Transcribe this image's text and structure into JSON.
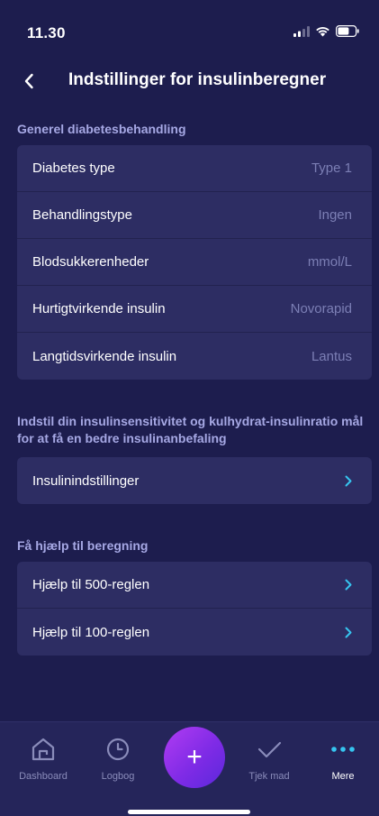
{
  "status_bar": {
    "time": "11.30",
    "icons": [
      "signal-icon",
      "wifi-icon",
      "battery-icon"
    ]
  },
  "header": {
    "title": "Indstillinger for insulinberegner",
    "back_icon": "chevron-left-icon"
  },
  "section_general": {
    "title": "Generel diabetesbehandling",
    "rows": [
      {
        "label": "Diabetes type",
        "value": "Type 1"
      },
      {
        "label": "Behandlingstype",
        "value": "Ingen"
      },
      {
        "label": "Blodsukkerenheder",
        "value": "mmol/L"
      },
      {
        "label": "Hurtigtvirkende insulin",
        "value": "Novorapid"
      },
      {
        "label": "Langtidsvirkende insulin",
        "value": "Lantus"
      }
    ]
  },
  "section_insulin": {
    "title": "Indstil din insulinsensitivitet og kulhydrat-insulinratio mål for at få en bedre insulinanbefaling",
    "rows": [
      {
        "label": "Insulinindstillinger"
      }
    ]
  },
  "section_help": {
    "title": "Få hjælp til beregning",
    "rows": [
      {
        "label": "Hjælp til 500-reglen"
      },
      {
        "label": "Hjælp til 100-reglen"
      }
    ]
  },
  "tab_bar": {
    "tabs": [
      {
        "label": "Dashboard",
        "icon": "home-icon"
      },
      {
        "label": "Logbog",
        "icon": "clock-icon"
      },
      {
        "label": "Tjek mad",
        "icon": "checkmark-icon"
      },
      {
        "label": "Mere",
        "icon": "more-dots-icon"
      }
    ],
    "active_tab": "Mere",
    "fab_icon": "plus-icon",
    "fab_symbol": "+"
  },
  "colors": {
    "background": "#1d1d4e",
    "card": "#2d2d63",
    "section_title": "#a6a8e4",
    "value_text": "#7c7fb5",
    "accent_chevron": "#36c5f0",
    "fab_gradient_start": "#b13cf2",
    "fab_gradient_end": "#5b28db"
  }
}
